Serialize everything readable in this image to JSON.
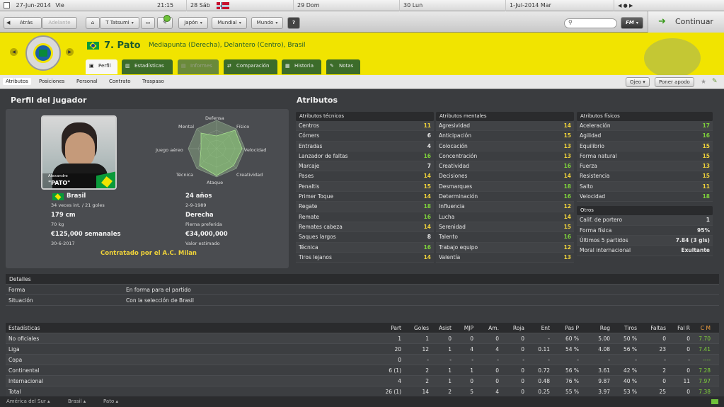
{
  "datebar": {
    "date": "27-Jun-2014",
    "day": "Vie",
    "time": "21:15",
    "d1": "28",
    "d1n": "Sáb",
    "d2": "29",
    "d2n": "Dom",
    "d3": "30",
    "d3n": "Lun",
    "d4": "1-Jul-2014",
    "d4n": "Mar"
  },
  "toolbar": {
    "back": "Atrás",
    "forward": "Adelante",
    "manager": "T Tatsumi",
    "nation": "Japón",
    "world_cup": "Mundial",
    "world": "Mundo",
    "help": "?",
    "continue": "Continuar",
    "fm": "FM"
  },
  "player": {
    "name": "7. Pato",
    "positions": "Mediapunta (Derecha), Delantero (Centro), Brasil",
    "photo_caption_small": "Alexandre",
    "photo_caption": "\"PATO\""
  },
  "tabs": [
    "Perfil",
    "Estadísticas",
    "Informes",
    "Comparación",
    "Historia",
    "Notas"
  ],
  "subtabs": [
    "Atributos",
    "Posiciones",
    "Personal",
    "Contrato",
    "Traspaso"
  ],
  "subbar_buttons": {
    "scout": "Ojeo",
    "nickname": "Poner apodo"
  },
  "sections": {
    "profile": "Perfil del jugador",
    "attributes": "Atributos",
    "details": "Detalles",
    "stats": "Estadísticas"
  },
  "radar_labels": [
    "Defensa",
    "Físico",
    "Velocidad",
    "Creatividad",
    "Ataque",
    "Técnica",
    "Juego aéreo",
    "Mental"
  ],
  "profile_info": {
    "nationality": "Brasil",
    "caps": "34 veces int. / 21 goles",
    "age": "24 años",
    "dob": "2-9-1989",
    "height": "179 cm",
    "weight": "70 kg",
    "foot": "Derecha",
    "foot_label": "Pierna preferida",
    "wage": "€125,000 semanales",
    "contract_end": "30-6-2017",
    "value": "€34,000,000",
    "value_label": "Valor estimado",
    "contracted": "Contratado por el A.C. Milan"
  },
  "technical": {
    "title": "Atributos técnicos",
    "rows": [
      [
        "Centros",
        "11"
      ],
      [
        "Córners",
        "6"
      ],
      [
        "Entradas",
        "4"
      ],
      [
        "Lanzador de faltas",
        "16"
      ],
      [
        "Marcaje",
        "7"
      ],
      [
        "Pases",
        "14"
      ],
      [
        "Penaltis",
        "15"
      ],
      [
        "Primer Toque",
        "14"
      ],
      [
        "Regate",
        "18"
      ],
      [
        "Remate",
        "16"
      ],
      [
        "Remates cabeza",
        "14"
      ],
      [
        "Saques largos",
        "8"
      ],
      [
        "Técnica",
        "16"
      ],
      [
        "Tiros lejanos",
        "14"
      ]
    ]
  },
  "mental": {
    "title": "Atributos mentales",
    "rows": [
      [
        "Agresividad",
        "14"
      ],
      [
        "Anticipación",
        "15"
      ],
      [
        "Colocación",
        "13"
      ],
      [
        "Concentración",
        "13"
      ],
      [
        "Creatividad",
        "16"
      ],
      [
        "Decisiones",
        "14"
      ],
      [
        "Desmarques",
        "18"
      ],
      [
        "Determinación",
        "16"
      ],
      [
        "Influencia",
        "12"
      ],
      [
        "Lucha",
        "14"
      ],
      [
        "Serenidad",
        "15"
      ],
      [
        "Talento",
        "16"
      ],
      [
        "Trabajo equipo",
        "12"
      ],
      [
        "Valentía",
        "13"
      ]
    ]
  },
  "physical": {
    "title": "Atributos físicos",
    "rows": [
      [
        "Aceleración",
        "17"
      ],
      [
        "Agilidad",
        "16"
      ],
      [
        "Equilibrio",
        "15"
      ],
      [
        "Forma natural",
        "15"
      ],
      [
        "Fuerza",
        "13"
      ],
      [
        "Resistencia",
        "15"
      ],
      [
        "Salto",
        "11"
      ],
      [
        "Velocidad",
        "18"
      ]
    ]
  },
  "others": {
    "title": "Otros",
    "rows": [
      [
        "Calif. de portero",
        "1"
      ],
      [
        "Forma física",
        "95%"
      ],
      [
        "Últimos 5 partidos",
        "7.84 (3 gls)"
      ],
      [
        "Moral internacional",
        "Exultante"
      ]
    ]
  },
  "details": [
    [
      "Forma",
      "En forma para el partido"
    ],
    [
      "Situación",
      "Con la selección de Brasil"
    ]
  ],
  "stats": {
    "headers": [
      "Part",
      "Goles",
      "Asist",
      "MJP",
      "Am.",
      "Roja",
      "Ent",
      "Pas P",
      "Reg",
      "Tiros",
      "Faltas",
      "Fal R",
      "C M"
    ],
    "rows": [
      [
        "No oficiales",
        "1",
        "1",
        "0",
        "0",
        "0",
        "0",
        "-",
        "60 %",
        "5.00",
        "50 %",
        "0",
        "0",
        "7.70"
      ],
      [
        "Liga",
        "20",
        "12",
        "1",
        "4",
        "4",
        "0",
        "0.11",
        "54 %",
        "4.08",
        "56 %",
        "23",
        "0",
        "7.41"
      ],
      [
        "Copa",
        "0",
        "-",
        "-",
        "-",
        "-",
        "-",
        "-",
        "-",
        "-",
        "-",
        "-",
        "-",
        "----"
      ],
      [
        "Continental",
        "6 (1)",
        "2",
        "1",
        "1",
        "0",
        "0",
        "0.72",
        "56 %",
        "3.61",
        "42 %",
        "2",
        "0",
        "7.28"
      ],
      [
        "Internacional",
        "4",
        "2",
        "1",
        "0",
        "0",
        "0",
        "0.48",
        "76 %",
        "9.87",
        "40 %",
        "0",
        "11",
        "7.97"
      ],
      [
        "Total",
        "26 (1)",
        "14",
        "2",
        "5",
        "4",
        "0",
        "0.25",
        "55 %",
        "3.97",
        "53 %",
        "25",
        "0",
        "7.38"
      ]
    ]
  },
  "footer": [
    "América del Sur",
    "Brasil",
    "Pato"
  ],
  "colors": {
    "accent_yellow": "#f1e400",
    "green": "#7fd23a"
  }
}
